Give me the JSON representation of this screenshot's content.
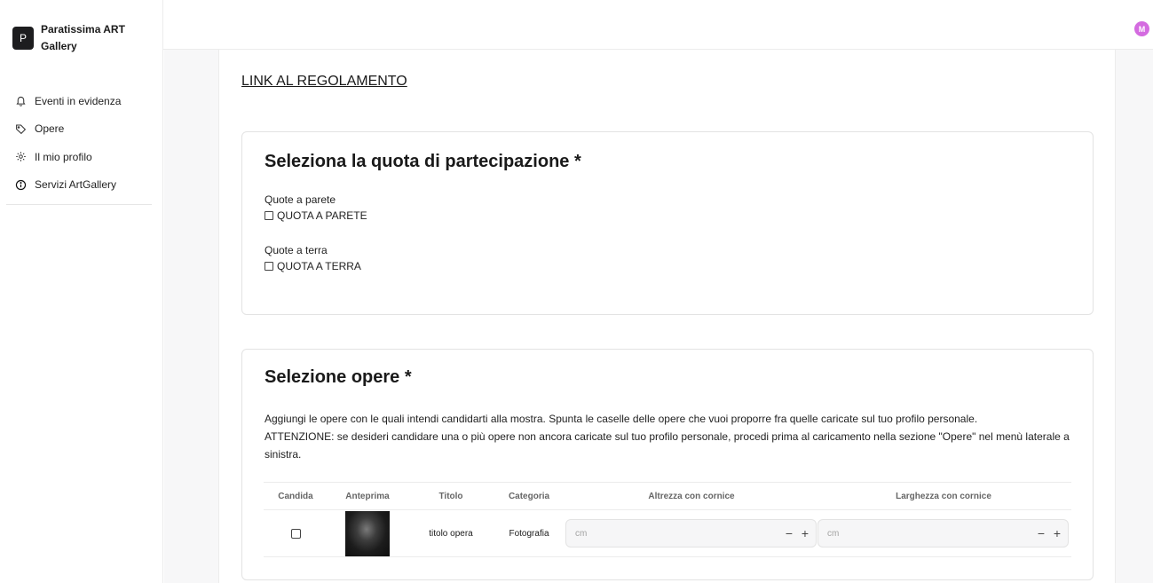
{
  "brand": {
    "logo_letter": "P",
    "name": "Paratissima ART Gallery"
  },
  "sidebar": {
    "items": [
      {
        "label": "Eventi in evidenza",
        "icon": "bell-icon"
      },
      {
        "label": "Opere",
        "icon": "tag-icon"
      },
      {
        "label": "Il mio profilo",
        "icon": "gear-icon"
      },
      {
        "label": "Servizi ArtGallery",
        "icon": "info-icon"
      }
    ]
  },
  "topbar": {
    "avatar_letter": "M",
    "avatar_color": "#d46be0"
  },
  "main": {
    "regulation_link": "LINK AL REGOLAMENTO",
    "quota_section": {
      "title": "Seleziona la quota di partecipazione *",
      "groups": [
        {
          "label": "Quote a parete",
          "option": "QUOTA A PARETE"
        },
        {
          "label": "Quote a terra",
          "option": "QUOTA A TERRA"
        }
      ]
    },
    "works_section": {
      "title": "Selezione opere *",
      "description_line1": "Aggiungi le opere con le quali intendi candidarti alla mostra. Spunta le caselle delle opere che vuoi proporre fra quelle caricate sul tuo profilo personale.",
      "description_line2": "ATTENZIONE: se desideri candidare una o più opere non ancora caricate sul tuo profilo personale, procedi prima al caricamento nella sezione \"Opere\" nel menù laterale a sinistra.",
      "table": {
        "headers": [
          "Candida",
          "Anteprima",
          "Titolo",
          "Categoria",
          "Altrezza con cornice",
          "Larghezza con cornice"
        ],
        "rows": [
          {
            "title": "titolo opera",
            "category": "Fotografia",
            "height_placeholder": "cm",
            "width_placeholder": "cm"
          }
        ],
        "stepper_minus": "−",
        "stepper_plus": "+"
      }
    }
  }
}
